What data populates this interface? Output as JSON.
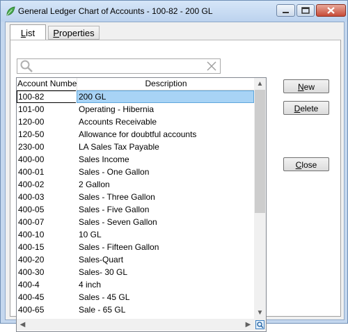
{
  "window": {
    "title": "General Ledger Chart of Accounts - 100-82 - 200 GL"
  },
  "tabs": [
    {
      "label": "List",
      "active": true
    },
    {
      "label": "Properties",
      "active": false
    }
  ],
  "search": {
    "value": "",
    "placeholder": ""
  },
  "grid": {
    "columns": [
      "Account Numbe",
      "Description"
    ],
    "rows": [
      {
        "account": "100-82",
        "description": "200 GL",
        "selected": true
      },
      {
        "account": "101-00",
        "description": "Operating - Hibernia"
      },
      {
        "account": "120-00",
        "description": "Accounts Receivable"
      },
      {
        "account": "120-50",
        "description": "Allowance for doubtful accounts"
      },
      {
        "account": "230-00",
        "description": "LA Sales Tax Payable"
      },
      {
        "account": "400-00",
        "description": "Sales Income"
      },
      {
        "account": "400-01",
        "description": "Sales - One Gallon"
      },
      {
        "account": "400-02",
        "description": "2 Gallon"
      },
      {
        "account": "400-03",
        "description": "Sales - Three Gallon"
      },
      {
        "account": "400-05",
        "description": "Sales - Five Gallon"
      },
      {
        "account": "400-07",
        "description": "Sales - Seven Gallon"
      },
      {
        "account": "400-10",
        "description": "10 GL"
      },
      {
        "account": "400-15",
        "description": "Sales - Fifteen Gallon"
      },
      {
        "account": "400-20",
        "description": "Sales-Quart"
      },
      {
        "account": "400-30",
        "description": "Sales- 30 GL"
      },
      {
        "account": "400-4",
        "description": "4 inch"
      },
      {
        "account": "400-45",
        "description": "Sales - 45 GL"
      },
      {
        "account": "400-65",
        "description": "Sale - 65 GL"
      }
    ]
  },
  "buttons": {
    "new": "New",
    "delete": "Delete",
    "close": "Close"
  },
  "colors": {
    "selection": "#a8d3f5",
    "titlebar": "#c4d7ee",
    "close_button": "#c74b38"
  },
  "icons": {
    "app": "green-leaf-icon",
    "search": "magnifier-icon",
    "clear": "x-clear-icon",
    "corner": "zoom-icon"
  }
}
